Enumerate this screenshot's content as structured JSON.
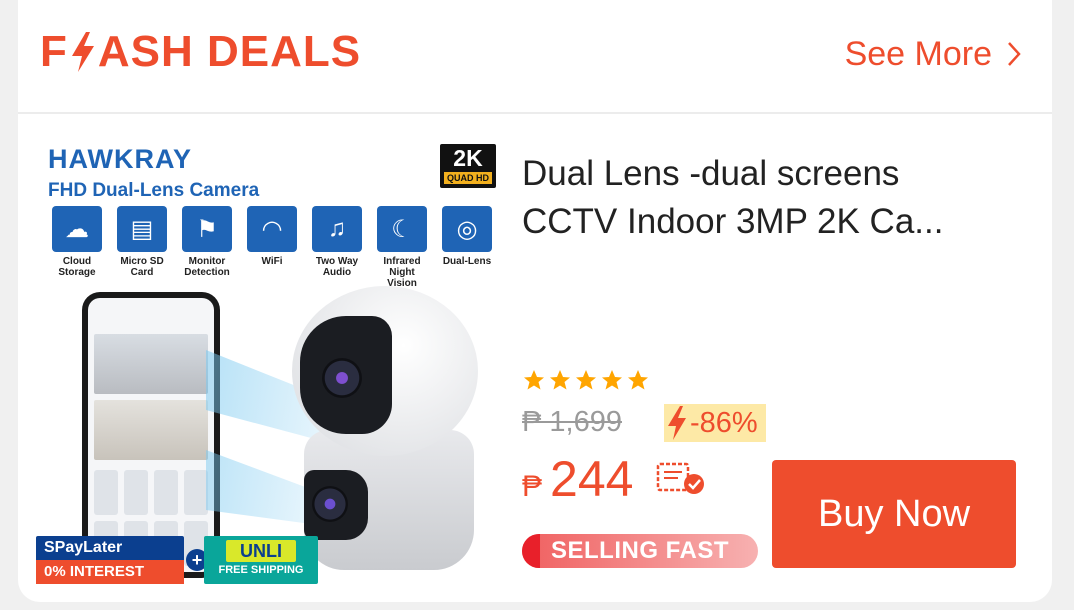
{
  "header": {
    "title": "FLASH DEALS",
    "title_rest": "ASH DEALS",
    "see_more_label": "See More"
  },
  "product": {
    "image_text": {
      "brand": "HAWKRAY",
      "subtitle": "FHD Dual-Lens Camera",
      "badge_main": "2K",
      "badge_sub": "QUAD HD",
      "features": [
        {
          "icon": "cloud-icon",
          "label": "Cloud Storage"
        },
        {
          "icon": "sd-card-icon",
          "label": "Micro SD Card"
        },
        {
          "icon": "motion-icon",
          "label": "Monitor Detection"
        },
        {
          "icon": "wifi-icon",
          "label": "WiFi"
        },
        {
          "icon": "audio-icon",
          "label": "Two Way Audio"
        },
        {
          "icon": "night-vision-icon",
          "label": "Infrared Night Vision"
        },
        {
          "icon": "dual-lens-icon",
          "label": "Dual-Lens"
        }
      ],
      "promo_spay_top": "SPayLater",
      "promo_spay_bottom": "0% INTEREST",
      "promo_unli_big": "UNLI",
      "promo_unli_small": "FREE SHIPPING"
    },
    "title": "Dual Lens -dual screens CCTV Indoor 3MP 2K Ca...",
    "rating_stars": 5,
    "original_price": "₱ 1,699",
    "discount": "-86%",
    "price_symbol": "₱",
    "price": "244",
    "selling_status": "SELLING FAST",
    "buy_label": "Buy Now"
  },
  "colors": {
    "accent": "#ee4d2d",
    "star": "#ffa500",
    "discount_bg": "#fde9a6",
    "brand_blue": "#1f64b5"
  }
}
